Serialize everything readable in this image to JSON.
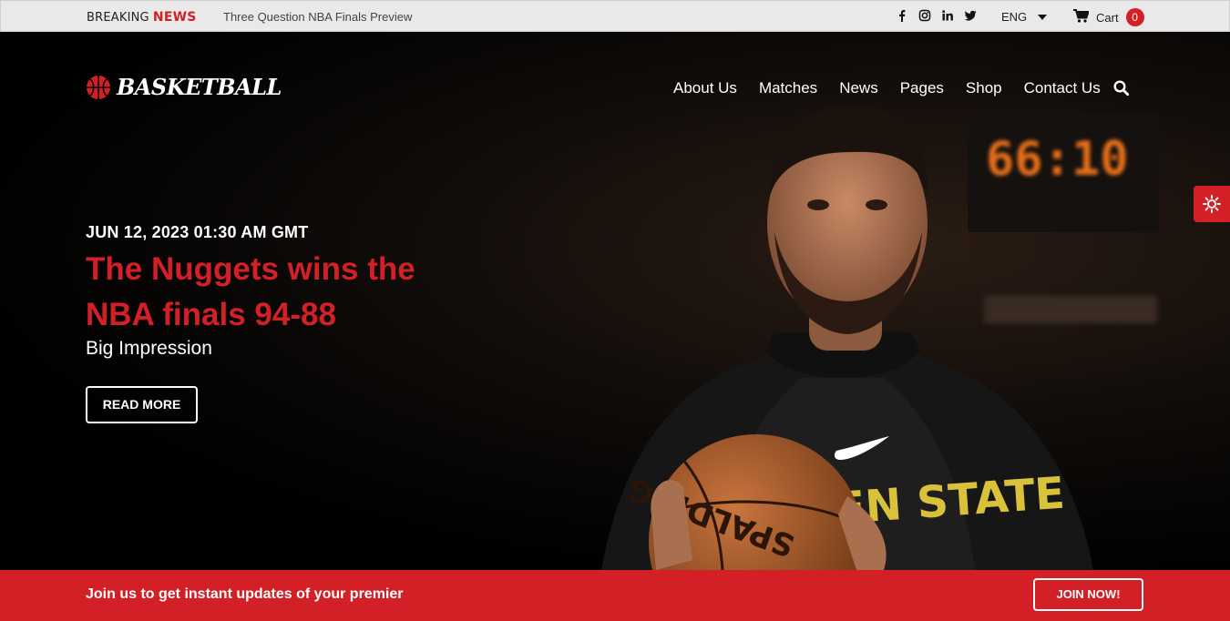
{
  "topbar": {
    "breaking_prefix": "BREAKING",
    "breaking_highlight": "NEWS",
    "ticker_text": "Three Question NBA Finals Preview",
    "social_icons": [
      "facebook-icon",
      "instagram-icon",
      "linkedin-icon",
      "twitter-icon"
    ],
    "language": "ENG",
    "cart_label": "Cart",
    "cart_count": "0"
  },
  "header": {
    "logo_text": "BASKETBALL",
    "nav": [
      "About Us",
      "Matches",
      "News",
      "Pages",
      "Shop",
      "Contact Us"
    ],
    "search_icon": "search-icon"
  },
  "hero": {
    "date": "JUN 12, 2023 01:30 AM GMT",
    "title": "The Nuggets wins the NBA finals 94-88",
    "subtitle": "Big Impression",
    "cta": "READ MORE",
    "jersey_text": "EN STATE",
    "ball_text": "SPALDING"
  },
  "sidebar_toggle": {
    "icon": "sun-icon"
  },
  "footer_bar": {
    "message": "Join us to get instant updates of your premier",
    "button": "JOIN NOW!"
  },
  "colors": {
    "accent": "#d32027",
    "topbar_bg": "#e9e9e9",
    "hero_bg": "#000000"
  }
}
